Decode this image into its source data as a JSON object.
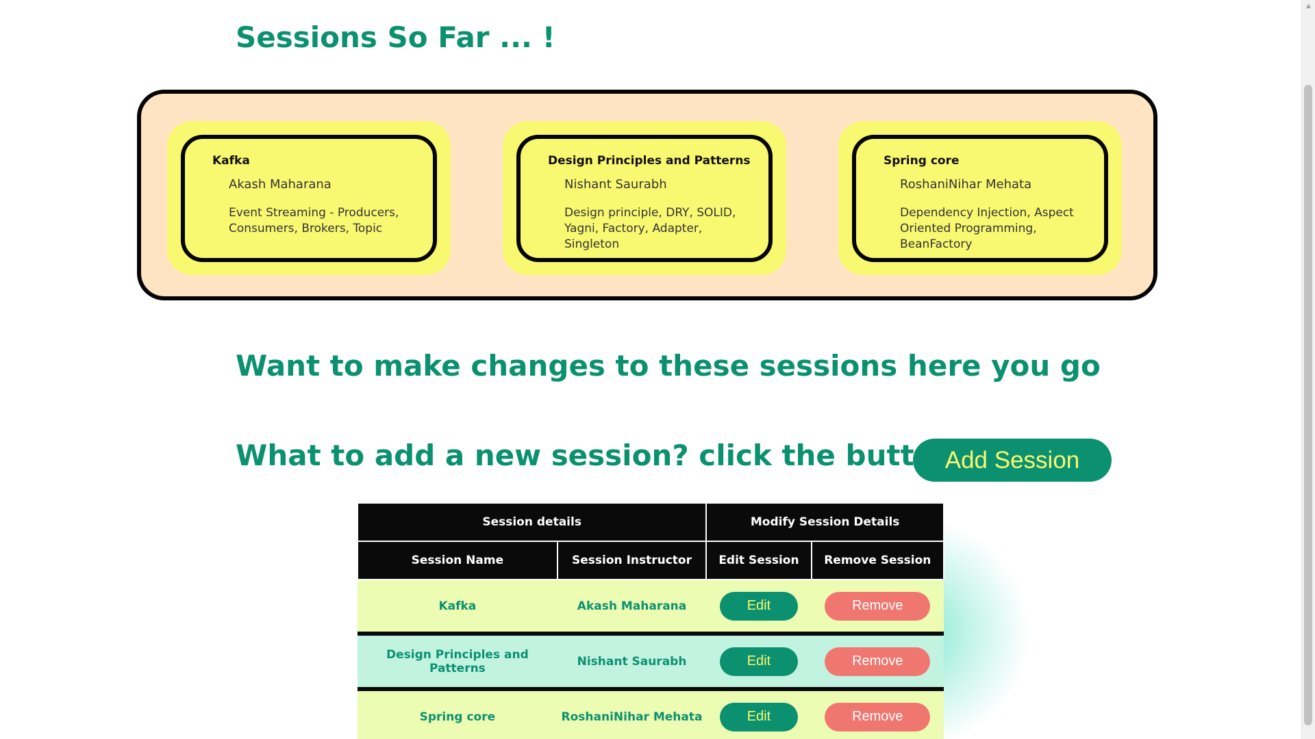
{
  "headings": {
    "sessions_so_far": "Sessions So Far ... !",
    "make_changes": "Want to make changes to these sessions here you go",
    "add_new": "What to add a new session? click the button :"
  },
  "add_session_button": "Add Session",
  "cards": [
    {
      "title": "Kafka",
      "instructor": "Akash Maharana",
      "description": "Event Streaming - Producers, Consumers, Brokers, Topic"
    },
    {
      "title": "Design Principles and Patterns",
      "instructor": "Nishant Saurabh",
      "description": "Design principle, DRY, SOLID, Yagni, Factory, Adapter, Singleton"
    },
    {
      "title": "Spring core",
      "instructor": "RoshaniNihar Mehata",
      "description": "Dependency Injection, Aspect Oriented Programming, BeanFactory"
    }
  ],
  "table": {
    "group_headers": [
      "Session details",
      "Modify Session Details"
    ],
    "column_headers": [
      "Session Name",
      "Session Instructor",
      "Edit Session",
      "Remove Session"
    ],
    "rows": [
      {
        "name": "Kafka",
        "instructor": "Akash Maharana",
        "edit": "Edit",
        "remove": "Remove"
      },
      {
        "name": "Design Principles and Patterns",
        "instructor": "Nishant Saurabh",
        "edit": "Edit",
        "remove": "Remove"
      },
      {
        "name": "Spring core",
        "instructor": "RoshaniNihar Mehata",
        "edit": "Edit",
        "remove": "Remove"
      }
    ]
  },
  "colors": {
    "accent": "#0b9170",
    "card_yellow": "#f9f871",
    "outer_peach": "#ffe4c4",
    "remove_red": "#f07670",
    "row_light_yellow": "#edfcb3",
    "row_light_teal": "#c2f3e1"
  },
  "icons": {
    "scroll_up": "chevron-up-icon"
  }
}
